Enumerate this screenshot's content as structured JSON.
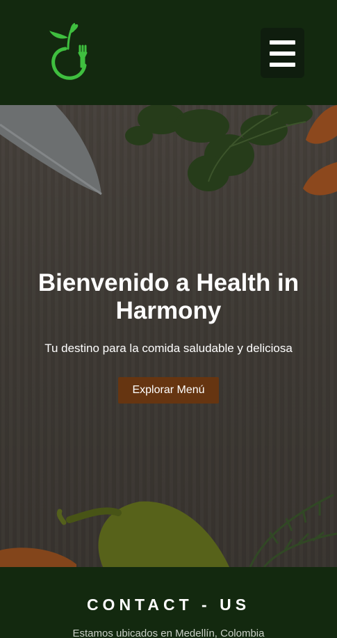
{
  "header": {
    "logo_icon": "leaf-fork-icon",
    "menu_icon": "hamburger-menu-icon"
  },
  "hero": {
    "title": "Bienvenido a Health in Harmony",
    "subtitle": "Tu destino para la comida saludable y deliciosa",
    "cta_label": "Explorar Menú"
  },
  "contact": {
    "title": "CONTACT - US",
    "location": "Estamos ubicados en Medellín, Colombia"
  },
  "colors": {
    "header_bg": "#13290f",
    "logo_green": "#3fbf3f",
    "cta_bg": "#663511",
    "text": "#ffffff"
  }
}
